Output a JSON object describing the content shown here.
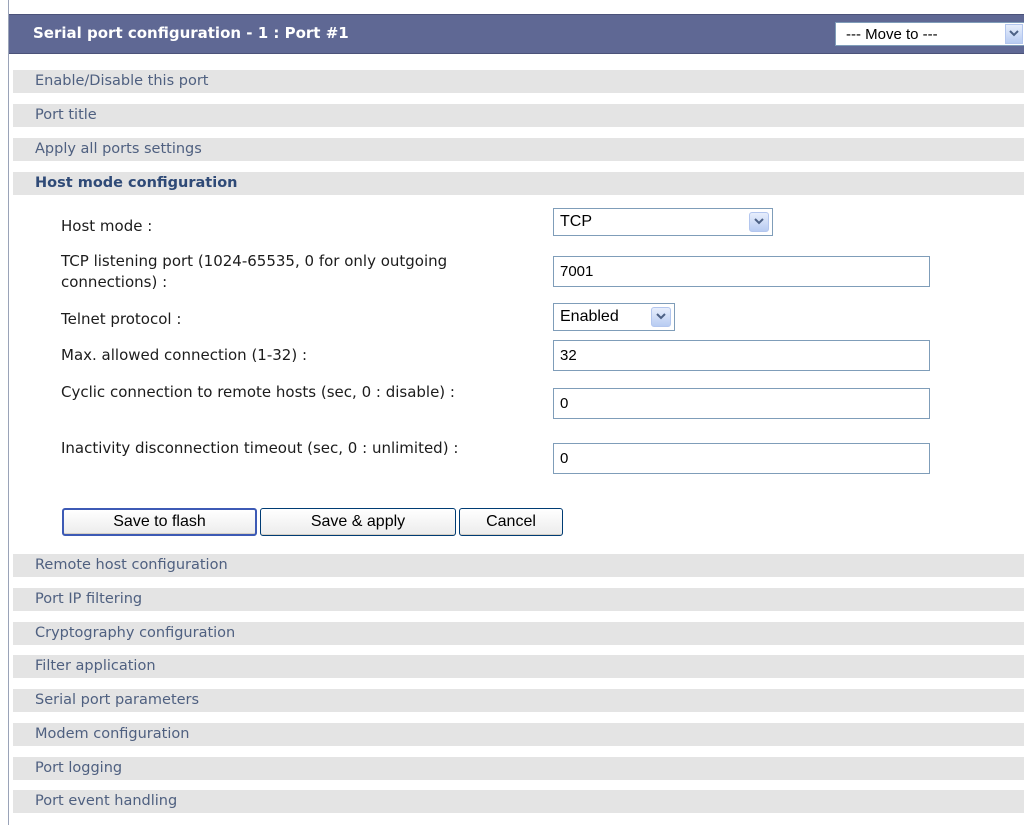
{
  "header": {
    "title": "Serial port configuration - 1 : Port #1",
    "move_to": "--- Move to ---"
  },
  "sections_top": [
    {
      "label": "Enable/Disable this port"
    },
    {
      "label": "Port title"
    },
    {
      "label": "Apply all ports settings"
    }
  ],
  "active_section": {
    "label": "Host mode configuration"
  },
  "form": {
    "host_mode": {
      "label": "Host mode :",
      "value": "TCP"
    },
    "tcp_port": {
      "label": "TCP listening port (1024-65535, 0 for only outgoing connections) :",
      "value": "7001"
    },
    "telnet": {
      "label": "Telnet protocol :",
      "value": "Enabled"
    },
    "max_conn": {
      "label": "Max. allowed connection (1-32) :",
      "value": "32"
    },
    "cyclic": {
      "label": "Cyclic connection to remote hosts (sec, 0 : disable) :",
      "value": "0"
    },
    "inactivity": {
      "label": "Inactivity disconnection timeout (sec, 0 : unlimited) :",
      "value": "0"
    }
  },
  "buttons": {
    "save_flash": "Save to flash",
    "save_apply": "Save & apply",
    "cancel": "Cancel"
  },
  "sections_bottom": [
    {
      "label": "Remote host configuration"
    },
    {
      "label": "Port IP filtering"
    },
    {
      "label": "Cryptography configuration"
    },
    {
      "label": "Filter application"
    },
    {
      "label": "Serial port parameters"
    },
    {
      "label": "Modem configuration"
    },
    {
      "label": "Port logging"
    },
    {
      "label": "Port event handling"
    }
  ],
  "colors": {
    "header_bg": "#5f6894",
    "section_bg": "#e4e4e4",
    "section_text": "#4f6080"
  }
}
